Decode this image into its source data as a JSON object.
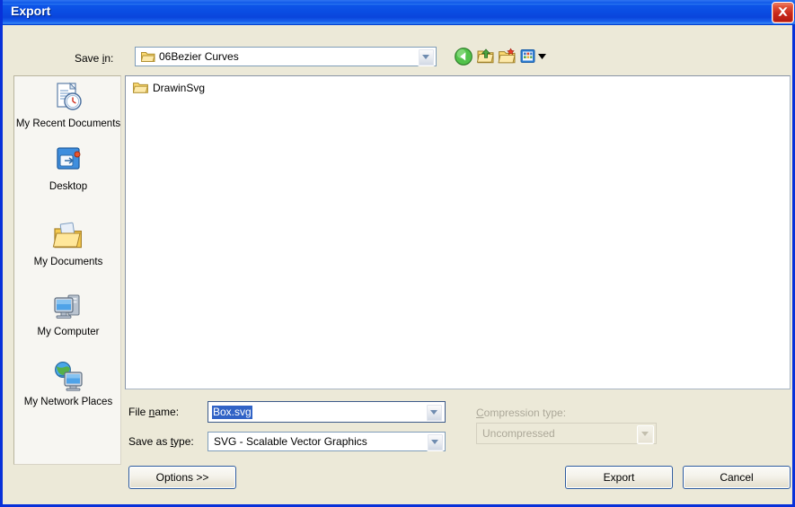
{
  "window": {
    "title": "Export",
    "close_label": "Close",
    "accent_titlebar": "#0a4ce2",
    "body_background": "#ece9d8"
  },
  "toolbar": {
    "save_in_label": "Save in:",
    "save_in_value": "06Bezier Curves",
    "buttons": [
      {
        "name": "back-button",
        "tooltip": "Back"
      },
      {
        "name": "up-one-level-button",
        "tooltip": "Up One Level"
      },
      {
        "name": "create-new-folder-button",
        "tooltip": "Create New Folder"
      },
      {
        "name": "views-button",
        "tooltip": "Views"
      }
    ]
  },
  "places_bar": {
    "items": [
      {
        "label": "My Recent Documents",
        "icon": "recent-documents-icon"
      },
      {
        "label": "Desktop",
        "icon": "desktop-icon"
      },
      {
        "label": "My Documents",
        "icon": "my-documents-icon"
      },
      {
        "label": "My Computer",
        "icon": "my-computer-icon"
      },
      {
        "label": "My Network Places",
        "icon": "my-network-places-icon"
      }
    ]
  },
  "file_list": {
    "items": [
      {
        "name": "DrawinSvg",
        "type": "folder"
      }
    ]
  },
  "form": {
    "file_name_label": "File name:",
    "file_name_value": "Box.svg",
    "save_as_type_label": "Save as type:",
    "save_as_type_value": "SVG - Scalable Vector Graphics",
    "compression_label": "Compression type:",
    "compression_value": "Uncompressed",
    "compression_disabled": true,
    "selection_color": "#3163c6"
  },
  "actions": {
    "options": "Options >>",
    "export": "Export",
    "cancel": "Cancel"
  }
}
